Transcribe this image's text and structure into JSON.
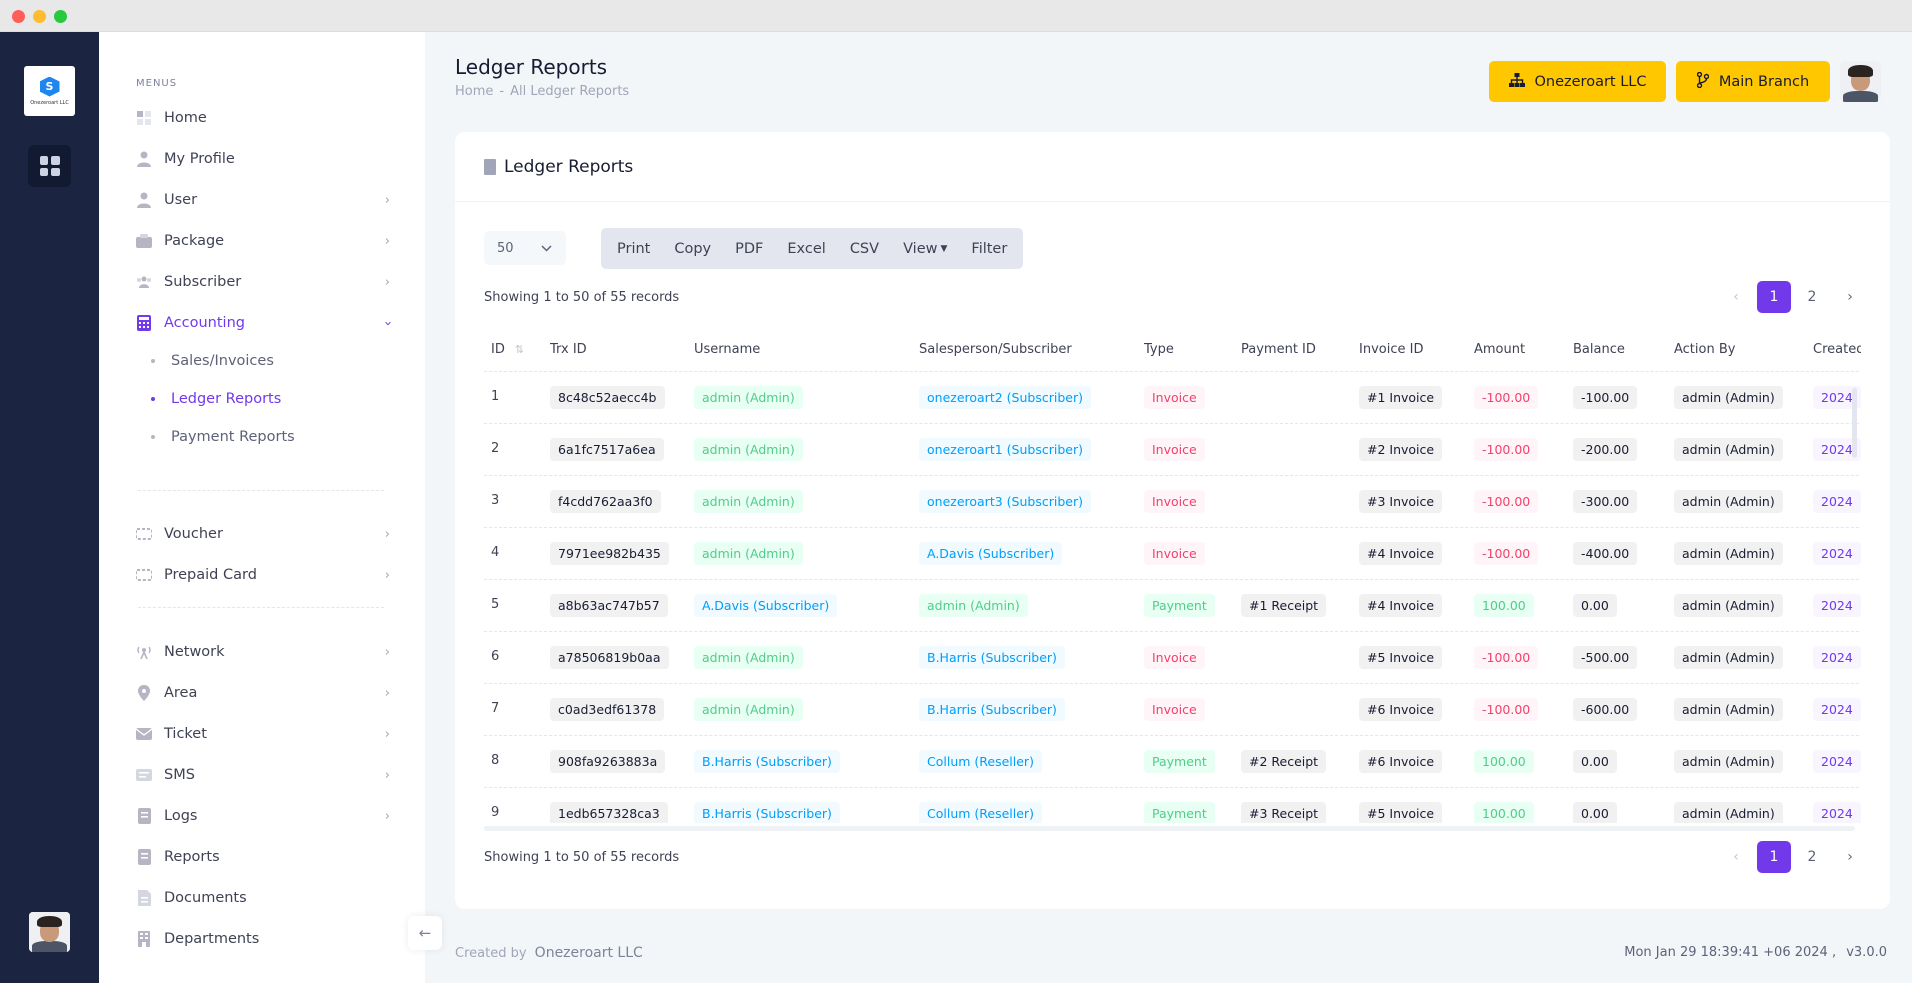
{
  "rail": {
    "logo_text": "Onezeroart LLC",
    "apps_icon": "grid-icon"
  },
  "sidebar": {
    "menus_title": "MENUS",
    "items": [
      {
        "label": "Home",
        "icon": "home-icon"
      },
      {
        "label": "My Profile",
        "icon": "profile-icon"
      },
      {
        "label": "User",
        "icon": "user-icon"
      },
      {
        "label": "Package",
        "icon": "package-icon"
      },
      {
        "label": "Subscriber",
        "icon": "subscriber-icon"
      },
      {
        "label": "Accounting",
        "icon": "calculator-icon"
      },
      {
        "label": "Voucher",
        "icon": "voucher-icon"
      },
      {
        "label": "Prepaid Card",
        "icon": "card-icon"
      },
      {
        "label": "Network",
        "icon": "network-icon"
      },
      {
        "label": "Area",
        "icon": "area-icon"
      },
      {
        "label": "Ticket",
        "icon": "ticket-icon"
      },
      {
        "label": "SMS",
        "icon": "sms-icon"
      },
      {
        "label": "Logs",
        "icon": "logs-icon"
      },
      {
        "label": "Reports",
        "icon": "reports-icon"
      },
      {
        "label": "Documents",
        "icon": "documents-icon"
      },
      {
        "label": "Departments",
        "icon": "departments-icon"
      }
    ],
    "accounting_sub": [
      {
        "label": "Sales/Invoices"
      },
      {
        "label": "Ledger Reports"
      },
      {
        "label": "Payment Reports"
      }
    ]
  },
  "header": {
    "title": "Ledger Reports",
    "breadcrumb": [
      "Home",
      "-",
      "All Ledger Reports"
    ],
    "org_button": "Onezeroart LLC",
    "branch_button": "Main Branch"
  },
  "card": {
    "title": "Ledger Reports",
    "page_length": "50",
    "buttons": [
      "Print",
      "Copy",
      "PDF",
      "Excel",
      "CSV",
      "View",
      "Filter"
    ],
    "info": "Showing 1 to 50 of 55 records",
    "pages": [
      "1",
      "2"
    ],
    "columns": [
      "ID",
      "Trx ID",
      "Username",
      "Salesperson/Subscriber",
      "Type",
      "Payment ID",
      "Invoice ID",
      "Amount",
      "Balance",
      "Action By",
      "Created"
    ],
    "rows": [
      {
        "id": "1",
        "trx": "8c48c52aecc4b",
        "user": "admin (Admin)",
        "user_type": "success",
        "sub": "onezeroart2 (Subscriber)",
        "sub_type": "info",
        "type": "Invoice",
        "pay": "",
        "inv": "#1 Invoice",
        "amount": "-100.00",
        "balance": "-100.00",
        "by": "admin (Admin)",
        "created": "2024"
      },
      {
        "id": "2",
        "trx": "6a1fc7517a6ea",
        "user": "admin (Admin)",
        "user_type": "success",
        "sub": "onezeroart1 (Subscriber)",
        "sub_type": "info",
        "type": "Invoice",
        "pay": "",
        "inv": "#2 Invoice",
        "amount": "-100.00",
        "balance": "-200.00",
        "by": "admin (Admin)",
        "created": "2024"
      },
      {
        "id": "3",
        "trx": "f4cdd762aa3f0",
        "user": "admin (Admin)",
        "user_type": "success",
        "sub": "onezeroart3 (Subscriber)",
        "sub_type": "info",
        "type": "Invoice",
        "pay": "",
        "inv": "#3 Invoice",
        "amount": "-100.00",
        "balance": "-300.00",
        "by": "admin (Admin)",
        "created": "2024"
      },
      {
        "id": "4",
        "trx": "7971ee982b435",
        "user": "admin (Admin)",
        "user_type": "success",
        "sub": "A.Davis (Subscriber)",
        "sub_type": "info",
        "type": "Invoice",
        "pay": "",
        "inv": "#4 Invoice",
        "amount": "-100.00",
        "balance": "-400.00",
        "by": "admin (Admin)",
        "created": "2024"
      },
      {
        "id": "5",
        "trx": "a8b63ac747b57",
        "user": "A.Davis (Subscriber)",
        "user_type": "info",
        "sub": "admin (Admin)",
        "sub_type": "success",
        "type": "Payment",
        "pay": "#1 Receipt",
        "inv": "#4 Invoice",
        "amount": "100.00",
        "balance": "0.00",
        "by": "admin (Admin)",
        "created": "2024"
      },
      {
        "id": "6",
        "trx": "a78506819b0aa",
        "user": "admin (Admin)",
        "user_type": "success",
        "sub": "B.Harris (Subscriber)",
        "sub_type": "info",
        "type": "Invoice",
        "pay": "",
        "inv": "#5 Invoice",
        "amount": "-100.00",
        "balance": "-500.00",
        "by": "admin (Admin)",
        "created": "2024"
      },
      {
        "id": "7",
        "trx": "c0ad3edf61378",
        "user": "admin (Admin)",
        "user_type": "success",
        "sub": "B.Harris (Subscriber)",
        "sub_type": "info",
        "type": "Invoice",
        "pay": "",
        "inv": "#6 Invoice",
        "amount": "-100.00",
        "balance": "-600.00",
        "by": "admin (Admin)",
        "created": "2024"
      },
      {
        "id": "8",
        "trx": "908fa9263883a",
        "user": "B.Harris (Subscriber)",
        "user_type": "info",
        "sub": "Collum (Reseller)",
        "sub_type": "info",
        "type": "Payment",
        "pay": "#2 Receipt",
        "inv": "#6 Invoice",
        "amount": "100.00",
        "balance": "0.00",
        "by": "admin (Admin)",
        "created": "2024"
      },
      {
        "id": "9",
        "trx": "1edb657328ca3",
        "user": "B.Harris (Subscriber)",
        "user_type": "info",
        "sub": "Collum (Reseller)",
        "sub_type": "info",
        "type": "Payment",
        "pay": "#3 Receipt",
        "inv": "#5 Invoice",
        "amount": "100.00",
        "balance": "0.00",
        "by": "admin (Admin)",
        "created": "2024"
      }
    ]
  },
  "footer": {
    "created_by": "Created by",
    "org": "Onezeroart LLC",
    "datetime": "Mon Jan 29 18:39:41 +06 2024 ,",
    "version": "v3.0.0"
  },
  "colors": {
    "accent": "#7239ea",
    "header_button": "#ffc700",
    "rail_bg": "#1b2541"
  }
}
